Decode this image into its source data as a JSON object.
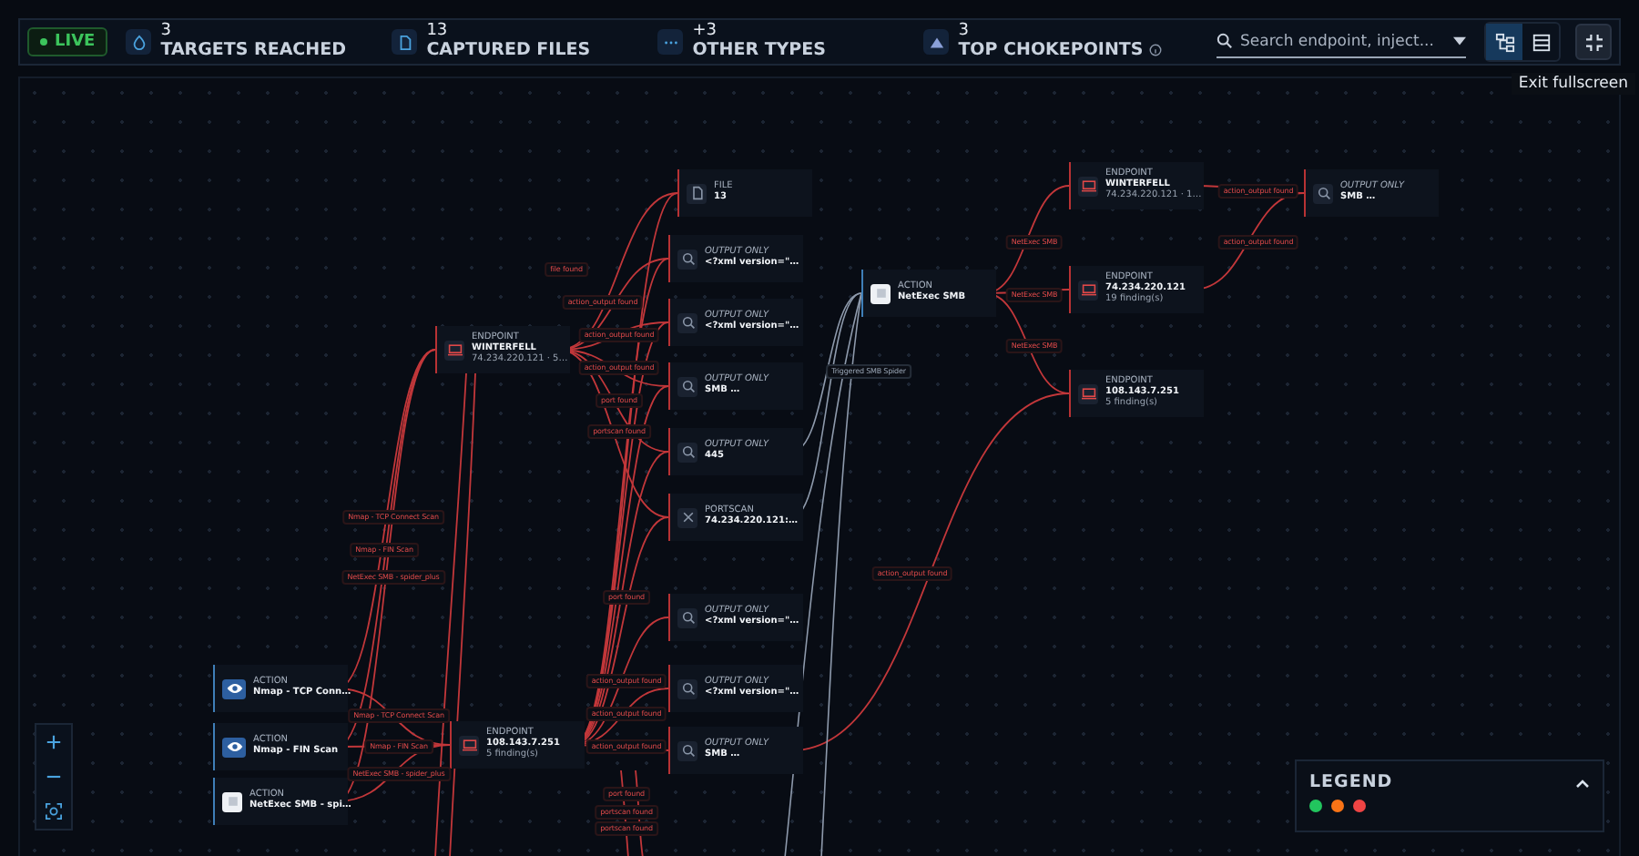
{
  "status": {
    "label": "LIVE",
    "live": true
  },
  "stats": [
    {
      "kind": "target",
      "value": "3",
      "label": "TARGETS REACHED"
    },
    {
      "kind": "file",
      "value": "13",
      "label": "CAPTURED FILES"
    },
    {
      "kind": "more",
      "value": "+3",
      "label": "OTHER TYPES"
    },
    {
      "kind": "choke",
      "value": "3",
      "label": "TOP CHOKEPOINTS",
      "info": true
    }
  ],
  "search": {
    "placeholder": "Search endpoint, inject..."
  },
  "view_toggle": [
    {
      "kind": "graph",
      "selected": true
    },
    {
      "kind": "table",
      "selected": false
    }
  ],
  "tooltip": "Exit fullscreen",
  "nodes": [
    {
      "kind": "file",
      "type_label": "FILE",
      "name": "13"
    },
    {
      "kind": "output",
      "type_label": "OUTPUT ONLY",
      "name": "<?xml version=\"…"
    },
    {
      "kind": "output",
      "type_label": "OUTPUT ONLY",
      "name": "<?xml version=\"…"
    },
    {
      "kind": "output",
      "type_label": "OUTPUT ONLY",
      "name": "SMB …"
    },
    {
      "kind": "output",
      "type_label": "OUTPUT ONLY",
      "name": "445"
    },
    {
      "kind": "portscan",
      "type_label": "PORTSCAN",
      "name": "74.234.220.121:…"
    },
    {
      "kind": "endpoint",
      "type_label": "ENDPOINT",
      "name": "WINTERFELL",
      "detail": "74.234.220.121 · 5…"
    },
    {
      "kind": "smb",
      "type_label": "ACTION",
      "name": "NetExec SMB"
    },
    {
      "kind": "endpoint",
      "type_label": "ENDPOINT",
      "name": "WINTERFELL",
      "detail": "74.234.220.121 · 1…"
    },
    {
      "kind": "output",
      "type_label": "OUTPUT ONLY",
      "name": "SMB …"
    },
    {
      "kind": "endpoint",
      "type_label": "ENDPOINT",
      "name": "74.234.220.121",
      "detail": "19 finding(s)"
    },
    {
      "kind": "endpoint",
      "type_label": "ENDPOINT",
      "name": "108.143.7.251",
      "detail": "5 finding(s)"
    },
    {
      "kind": "output",
      "type_label": "OUTPUT ONLY",
      "name": "<?xml version=\"…"
    },
    {
      "kind": "scanner",
      "type_label": "ACTION",
      "name": "Nmap - TCP Conn…"
    },
    {
      "kind": "output",
      "type_label": "OUTPUT ONLY",
      "name": "<?xml version=\"…"
    },
    {
      "kind": "scanner",
      "type_label": "ACTION",
      "name": "Nmap - FIN Scan"
    },
    {
      "kind": "endpoint",
      "type_label": "ENDPOINT",
      "name": "108.143.7.251",
      "detail": "5 finding(s)"
    },
    {
      "kind": "output",
      "type_label": "OUTPUT ONLY",
      "name": "SMB …"
    },
    {
      "kind": "smb",
      "type_label": "ACTION",
      "name": "NetExec SMB - spi…"
    }
  ],
  "edge_labels": [
    {
      "text": "file found",
      "kind": "red"
    },
    {
      "text": "action_output found",
      "kind": "red"
    },
    {
      "text": "action_output found",
      "kind": "red"
    },
    {
      "text": "action_output found",
      "kind": "red"
    },
    {
      "text": "port found",
      "kind": "red"
    },
    {
      "text": "portscan found",
      "kind": "red"
    },
    {
      "text": "Triggered SMB Spider",
      "kind": "grey"
    },
    {
      "text": "NetExec SMB",
      "kind": "red"
    },
    {
      "text": "NetExec SMB",
      "kind": "red"
    },
    {
      "text": "NetExec SMB",
      "kind": "red"
    },
    {
      "text": "action_output found",
      "kind": "red"
    },
    {
      "text": "action_output found",
      "kind": "red"
    },
    {
      "text": "action_output found",
      "kind": "red"
    },
    {
      "text": "Nmap - TCP Connect Scan",
      "kind": "red"
    },
    {
      "text": "Nmap - FIN Scan",
      "kind": "red"
    },
    {
      "text": "NetExec SMB - spider_plus",
      "kind": "red"
    },
    {
      "text": "Nmap - TCP Connect Scan",
      "kind": "red"
    },
    {
      "text": "Nmap - FIN Scan",
      "kind": "red"
    },
    {
      "text": "NetExec SMB - spider_plus",
      "kind": "red"
    },
    {
      "text": "port found",
      "kind": "red"
    },
    {
      "text": "action_output found",
      "kind": "red"
    },
    {
      "text": "action_output found",
      "kind": "red"
    },
    {
      "text": "action_output found",
      "kind": "red"
    },
    {
      "text": "port found",
      "kind": "red"
    },
    {
      "text": "portscan found",
      "kind": "red"
    },
    {
      "text": "portscan found",
      "kind": "red"
    }
  ],
  "legend": {
    "title": "LEGEND",
    "expanded": true,
    "dots": [
      {
        "color": "#22c55e"
      },
      {
        "color": "#f97316"
      },
      {
        "color": "#ef4444"
      }
    ]
  }
}
